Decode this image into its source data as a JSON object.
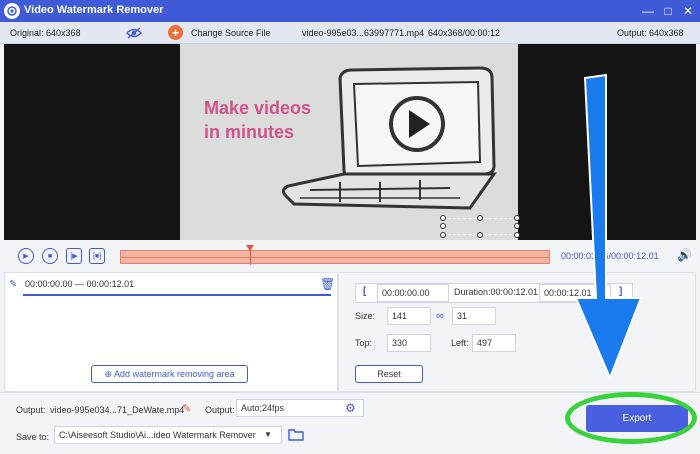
{
  "window": {
    "title": "Video Watermark Remover",
    "controls": {
      "minimize": "—",
      "maximize": "□",
      "close": "✕"
    }
  },
  "infobar": {
    "original": "Original: 640x368",
    "change_source": "Change Source File",
    "filename": "video-995e03...63997771.mp4",
    "file_meta": "640x368/00:00:12",
    "output": "Output: 640x368"
  },
  "preview": {
    "headline_line1": "Make videos",
    "headline_line2": "in minutes"
  },
  "player": {
    "timecode": "00:00:03.16/00:00:12.01",
    "playhead_fraction": 0.3
  },
  "segments": {
    "range": "00:00:00.00 — 00:00:12.01",
    "add_button": "Add watermark removing area"
  },
  "area": {
    "start": "00:00:00.00",
    "duration_label": "Duration:00:00:12.01",
    "end": "00:00:12.01",
    "size_label": "Size:",
    "width": "141",
    "height": "31",
    "top_label": "Top:",
    "top": "330",
    "left_label": "Left:",
    "left": "497",
    "reset": "Reset"
  },
  "bottom": {
    "output_label": "Output:",
    "output_file": "video-995e034...71_DeWate.mp4",
    "output_format_label": "Output:",
    "output_format": "Auto;24fps",
    "save_label": "Save to:",
    "save_path": "C:\\Aiseesoft Studio\\Ai...ideo Watermark Remover",
    "export": "Export"
  },
  "colors": {
    "accent": "#3f5bd8",
    "titlebar": "#3f5bd8",
    "timeline": "#f4b4a4",
    "highlight_ellipse": "#3ad23a",
    "arrow": "#1a7bef"
  }
}
